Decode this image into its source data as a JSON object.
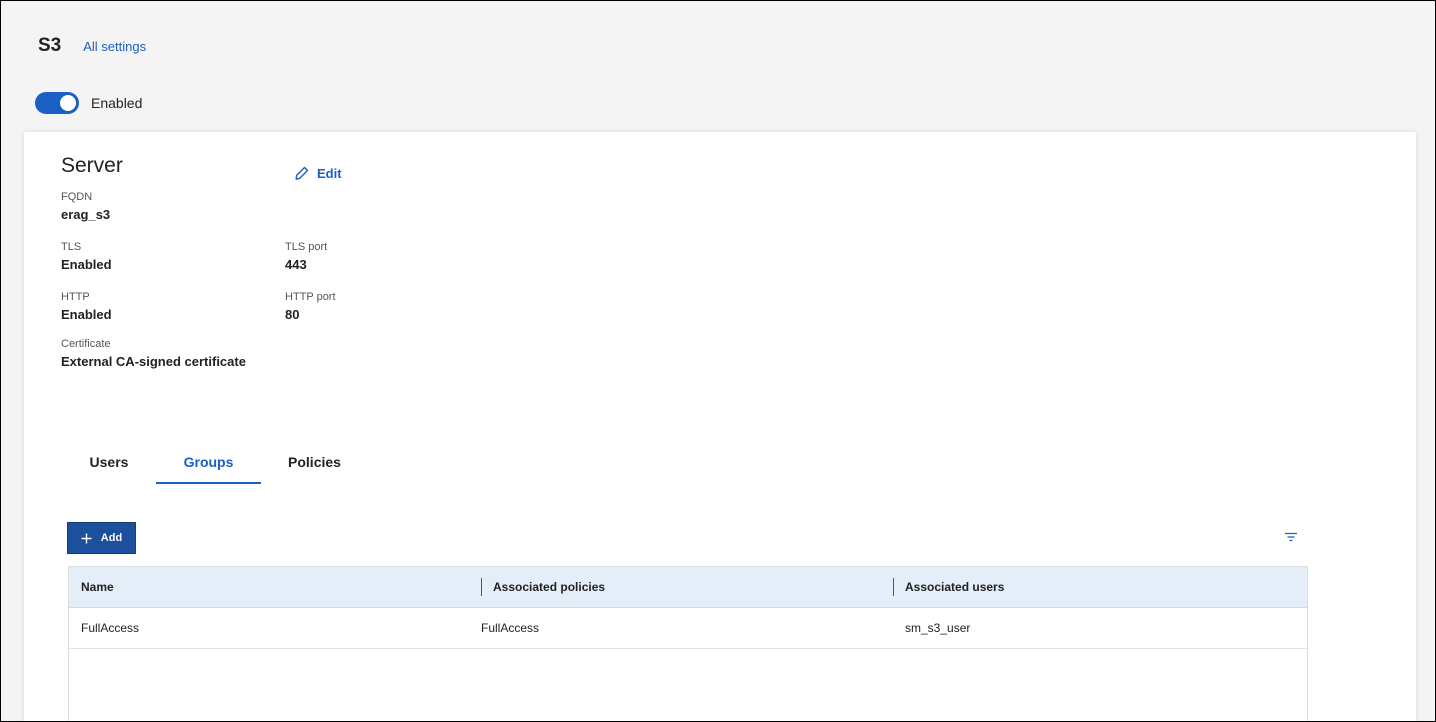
{
  "header": {
    "title": "S3",
    "all_settings_link": "All settings"
  },
  "status": {
    "toggle_on": true,
    "label": "Enabled"
  },
  "server": {
    "title": "Server",
    "edit_label": "Edit",
    "fqdn": {
      "key": "FQDN",
      "value": "erag_s3"
    },
    "tls": {
      "key": "TLS",
      "value": "Enabled"
    },
    "tls_port": {
      "key": "TLS port",
      "value": "443"
    },
    "http": {
      "key": "HTTP",
      "value": "Enabled"
    },
    "http_port": {
      "key": "HTTP port",
      "value": "80"
    },
    "certificate": {
      "key": "Certificate",
      "value": "External CA-signed certificate"
    }
  },
  "tabs": [
    {
      "label": "Users",
      "active": false
    },
    {
      "label": "Groups",
      "active": true
    },
    {
      "label": "Policies",
      "active": false
    }
  ],
  "toolbar": {
    "add_label": "Add",
    "filter_icon": "filter-icon"
  },
  "table": {
    "columns": [
      "Name",
      "Associated policies",
      "Associated users"
    ],
    "rows": [
      [
        "FullAccess",
        "FullAccess",
        "sm_s3_user"
      ]
    ]
  },
  "colors": {
    "accent": "#1a5fc4",
    "add_button": "#1c4f9c",
    "table_header": "#e3eef9"
  }
}
